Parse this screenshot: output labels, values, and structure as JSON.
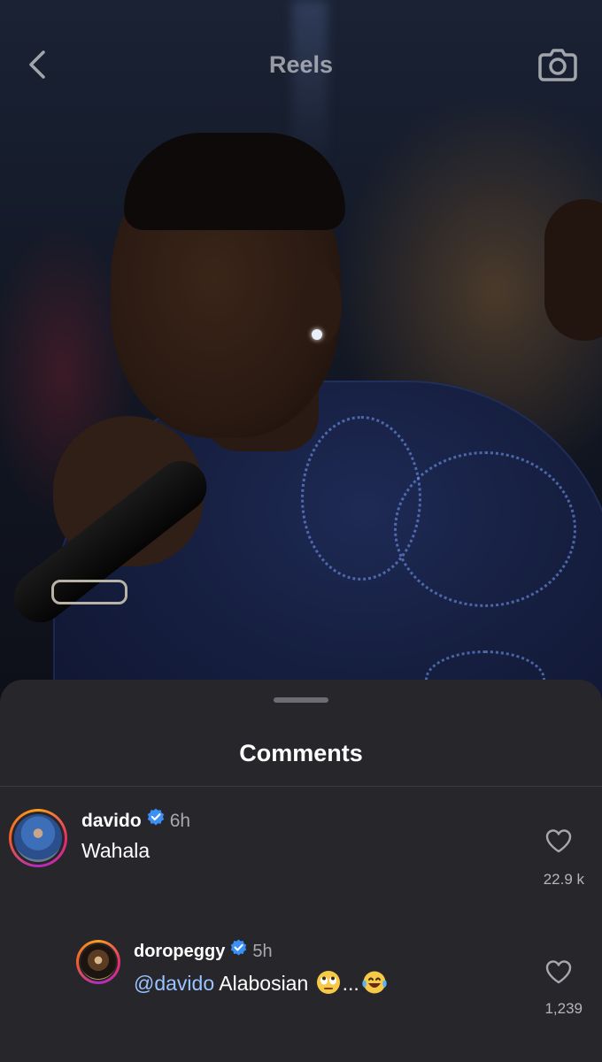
{
  "header": {
    "title": "Reels",
    "back_icon": "chevron-left-icon",
    "camera_icon": "camera-icon"
  },
  "sheet": {
    "title": "Comments"
  },
  "comments": [
    {
      "username": "davido",
      "verified": true,
      "time": "6h",
      "text": "Wahala",
      "likes": "22.9 k"
    },
    {
      "username": "doropeggy",
      "verified": true,
      "time": "5h",
      "mention": "@davido",
      "text": " Alabosian ",
      "text_tail": "...",
      "emojis": [
        "face-with-rolling-eyes",
        "face-with-tears-of-joy"
      ],
      "likes": "1,239"
    }
  ],
  "colors": {
    "sheet_bg": "#26262b",
    "mention": "#9ac4ff",
    "verified": "#3b8ff5"
  }
}
